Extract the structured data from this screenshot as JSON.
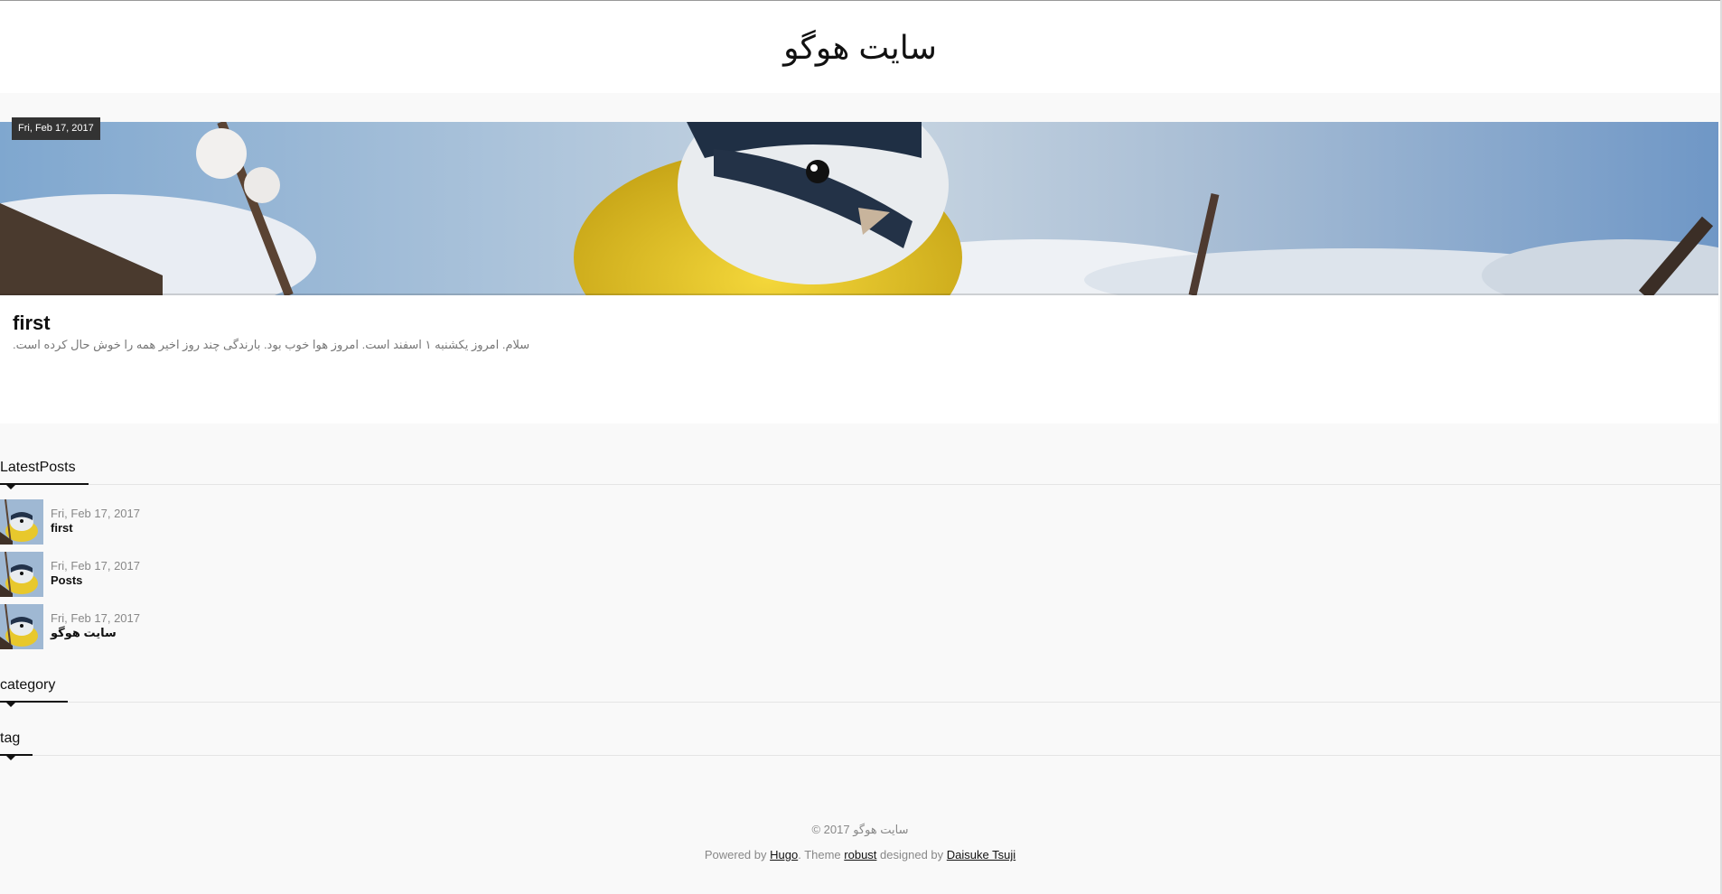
{
  "header": {
    "site_title": "سایت هوگو"
  },
  "featured_post": {
    "date": "Fri, Feb 17, 2017",
    "title": "first",
    "summary": "سلام. امروز یکشنبه ۱ اسفند است. امروز هوا خوب بود. بارندگی چند روز اخیر همه را خوش حال کرده است."
  },
  "sidebar": {
    "latest_posts": {
      "heading": "LatestPosts",
      "items": [
        {
          "date": "Fri, Feb 17, 2017",
          "title": "first"
        },
        {
          "date": "Fri, Feb 17, 2017",
          "title": "Posts"
        },
        {
          "date": "Fri, Feb 17, 2017",
          "title": "سایت هوگو"
        }
      ]
    },
    "category": {
      "heading": "category"
    },
    "tag": {
      "heading": "tag"
    }
  },
  "footer": {
    "copyright": "© 2017 سایت هوگو",
    "powered_prefix": "Powered by",
    "hugo_link": "Hugo",
    "theme_prefix": ". Theme",
    "theme_link": "robust",
    "designed_prefix": "designed by",
    "designer_link": "Daisuke Tsuji"
  },
  "colors": {
    "background": "#f9f9f9",
    "card": "#ffffff",
    "badge": "#333333",
    "muted_text": "#888888"
  }
}
